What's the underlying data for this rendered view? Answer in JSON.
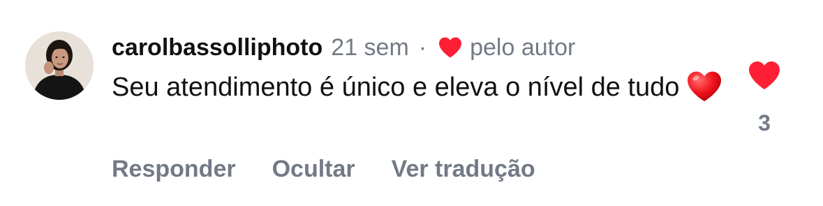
{
  "comment": {
    "username": "carolbassolliphoto",
    "time_ago": "21 sem",
    "separator": "·",
    "liked_by_author_label": "pelo autor",
    "text": "Seu atendimento é único e eleva o nível de tudo",
    "emoji": "heart-emoji",
    "like_count": "3",
    "liked": true,
    "like_color": "#ff1f35"
  },
  "actions": {
    "reply_label": "Responder",
    "hide_label": "Ocultar",
    "translate_label": "Ver tradução"
  },
  "colors": {
    "meta_gray": "#737a86",
    "text": "#111111",
    "heart_red": "#ff1f35"
  }
}
